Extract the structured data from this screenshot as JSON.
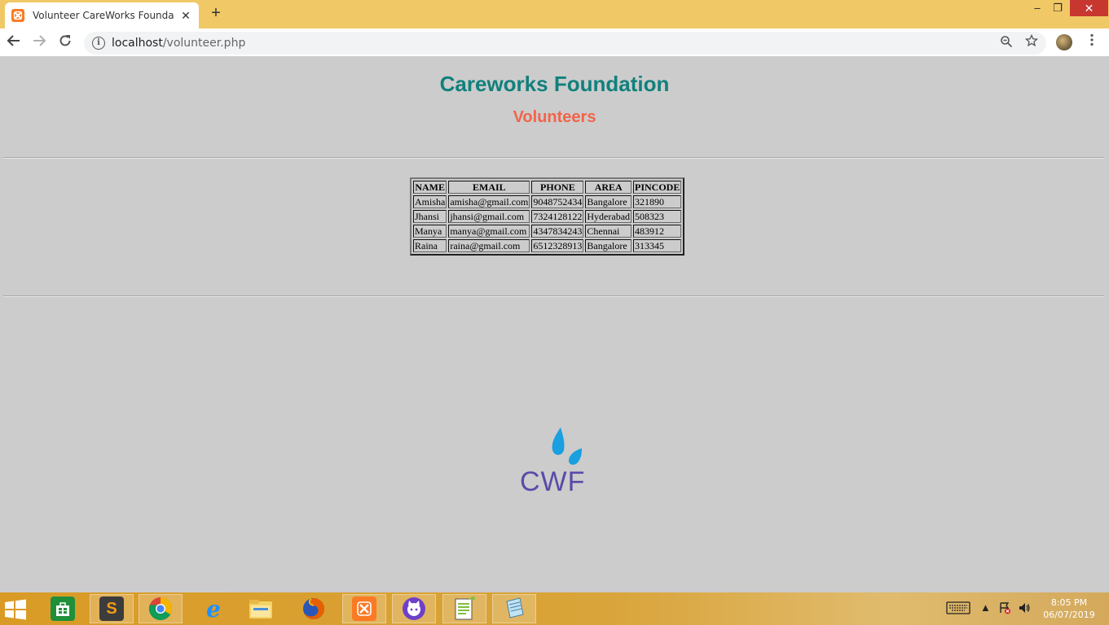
{
  "browser": {
    "tab_title": "Volunteer CareWorks Foundation",
    "tab_close": "✕",
    "new_tab": "+",
    "url_host": "localhost",
    "url_path": "/volunteer.php",
    "window_minimize": "–",
    "window_restore": "❐",
    "window_close": "✕"
  },
  "page": {
    "title": "Careworks Foundation",
    "subtitle": "Volunteers",
    "logo_text": "CWF",
    "table": {
      "headers": [
        "NAME",
        "EMAIL",
        "PHONE",
        "AREA",
        "PINCODE"
      ],
      "rows": [
        [
          "Amisha",
          "amisha@gmail.com",
          "9048752434",
          "Bangalore",
          "321890"
        ],
        [
          "Jhansi",
          "jhansi@gmail.com",
          "7324128122",
          "Hyderabad",
          "508323"
        ],
        [
          "Manya",
          "manya@gmail.com",
          "4347834243",
          "Chennai",
          "483912"
        ],
        [
          "Raina",
          "raina@gmail.com",
          "6512328913",
          "Bangalore",
          "313345"
        ]
      ]
    }
  },
  "taskbar": {
    "apps": [
      "store",
      "sublime-text",
      "chrome",
      "internet-explorer",
      "file-explorer",
      "firefox",
      "xampp",
      "github-desktop",
      "notepad-plus",
      "notepad"
    ],
    "active_app": "chrome",
    "time": "8:05 PM",
    "date": "06/07/2019"
  },
  "colors": {
    "title": "#11807d",
    "subtitle": "#f2644a",
    "page_bg": "#cccccc",
    "titlebar": "#f1c866",
    "logo_drop": "#1a9fe0",
    "logo_text": "#5b4aa8"
  }
}
